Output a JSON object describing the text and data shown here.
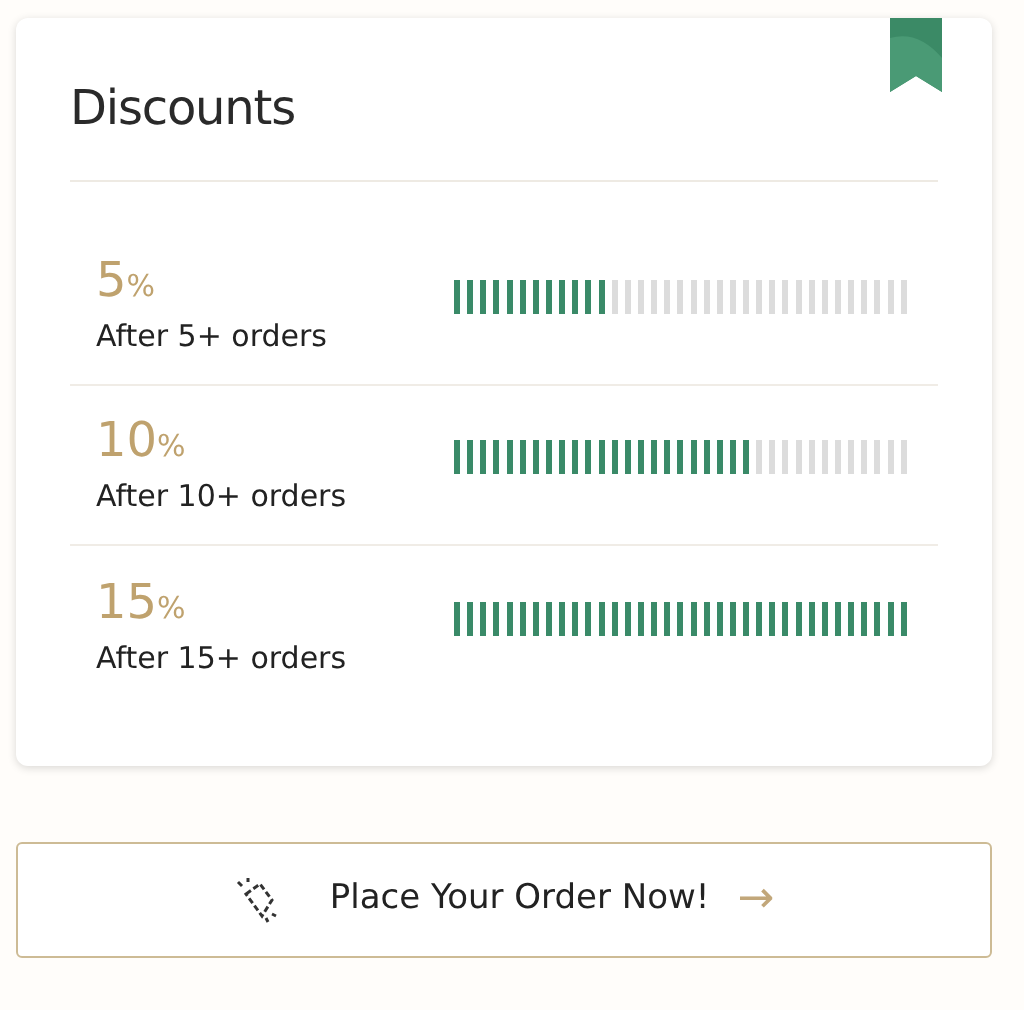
{
  "card": {
    "title": "Discounts",
    "bookmarked": true
  },
  "discounts": [
    {
      "value": "5",
      "unit": "%",
      "label": "After 5+ orders",
      "level": 0.34
    },
    {
      "value": "10",
      "unit": "%",
      "label": "After 10+ orders",
      "level": 0.66
    },
    {
      "value": "15",
      "unit": "%",
      "label": "After 15+ orders",
      "level": 1.0
    }
  ],
  "order_button": {
    "label": "Place Your Order Now!",
    "arrow": "→"
  }
}
